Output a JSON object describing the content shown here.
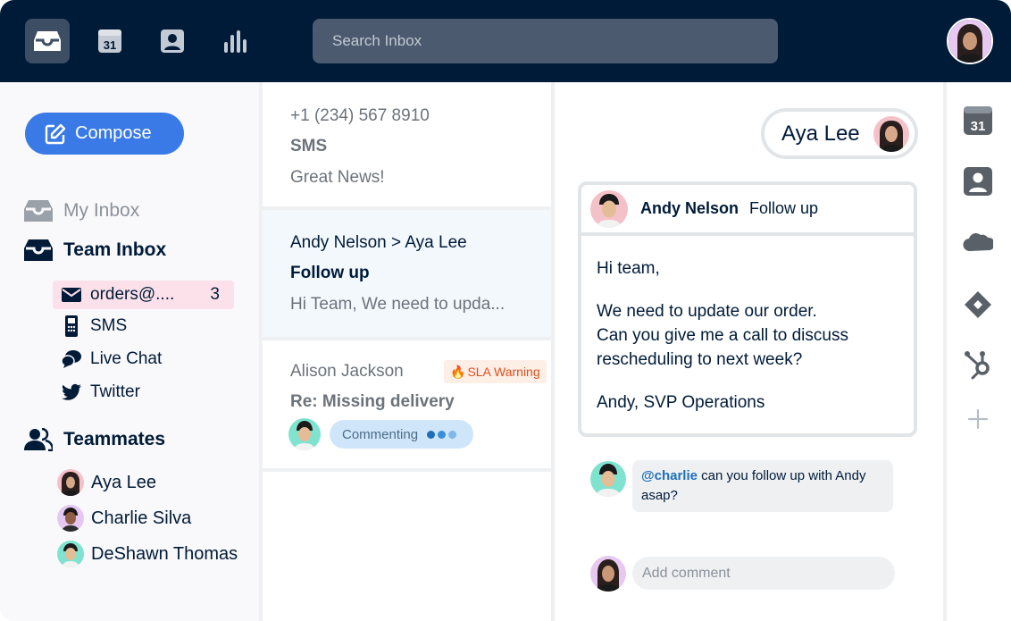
{
  "header": {
    "nav": [
      {
        "icon": "inbox-icon",
        "active": true
      },
      {
        "icon": "calendar-icon",
        "active": false,
        "label": "31"
      },
      {
        "icon": "contact-icon",
        "active": false
      },
      {
        "icon": "analytics-icon",
        "active": false
      }
    ],
    "search_placeholder": "Search Inbox"
  },
  "sidebar": {
    "compose_label": "Compose",
    "my_inbox": "My Inbox",
    "team_inbox": "Team Inbox",
    "channels": [
      {
        "label": "orders@....",
        "count": "3",
        "icon": "envelope-icon",
        "selected": true
      },
      {
        "label": "SMS",
        "icon": "phone-icon"
      },
      {
        "label": "Live Chat",
        "icon": "chat-icon"
      },
      {
        "label": "Twitter",
        "icon": "twitter-icon"
      }
    ],
    "teammates_label": "Teammates",
    "teammates": [
      {
        "name": "Aya Lee"
      },
      {
        "name": "Charlie Silva"
      },
      {
        "name": "DeShawn Thomas"
      }
    ]
  },
  "conversations": [
    {
      "from": "+1 (234) 567 8910",
      "subject": "SMS",
      "preview": "Great News!"
    },
    {
      "from": "Andy Nelson > Aya Lee",
      "subject": "Follow up",
      "preview": "Hi Team, We need to upda..."
    },
    {
      "from": "Alison Jackson",
      "subject": "Re: Missing delivery",
      "badge": "SLA Warning",
      "status": "Commenting"
    }
  ],
  "detail": {
    "assignee": "Aya Lee",
    "message": {
      "sender": "Andy Nelson",
      "subject": "Follow up",
      "greeting": "Hi team,",
      "body_line1": "We need to update our order.",
      "body_line2": "Can you give me a call to discuss",
      "body_line3": "rescheduling to next week?",
      "signature": "Andy, SVP Operations"
    },
    "comment": {
      "mention": "@charlie",
      "text": " can you follow up with Andy asap?"
    },
    "add_comment_placeholder": "Add comment"
  },
  "rail": {
    "calendar_label": "31",
    "items": [
      "calendar-icon",
      "contact-icon",
      "salesforce-icon",
      "jira-icon",
      "hubspot-icon",
      "plus-icon"
    ]
  },
  "colors": {
    "topbar": "#001b38",
    "accent": "#3a7ae6",
    "selected": "#fde1ea",
    "sla": "#e0501e"
  }
}
